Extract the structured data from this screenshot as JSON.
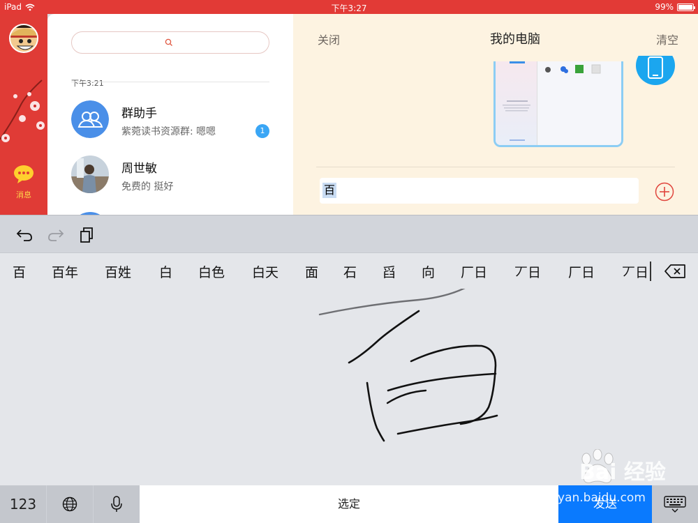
{
  "status_bar": {
    "device": "iPad",
    "time": "下午3:27",
    "battery": "99%",
    "battery_level": 0.99
  },
  "sidebar": {
    "active_label": "消息"
  },
  "chat_list": {
    "section_time": "下午3:21",
    "rows": [
      {
        "name": "群助手",
        "preview": "紫菀读书资源群: 嗯嗯",
        "badge": "1"
      },
      {
        "name": "周世敏",
        "preview": "免费的 挺好"
      }
    ]
  },
  "chat": {
    "close_label": "关闭",
    "title": "我的电脑",
    "clear_label": "清空",
    "input_value": "百"
  },
  "candidates": [
    "百",
    "百年",
    "百姓",
    "白",
    "白色",
    "白天",
    "面",
    "石",
    "舀",
    "向",
    "厂日",
    "丆日",
    "厂日",
    "丆日"
  ],
  "keyboard": {
    "key_123": "123",
    "select_label": "选定",
    "send_label": "发送"
  },
  "watermark": {
    "brand": "Bai 经验",
    "url": "jingyan.baidu.com"
  },
  "colors": {
    "brand_red": "#e23a36",
    "send_blue": "#0a7afe",
    "badge_blue": "#3aa6f5",
    "chat_bg": "#fdf3e1"
  }
}
